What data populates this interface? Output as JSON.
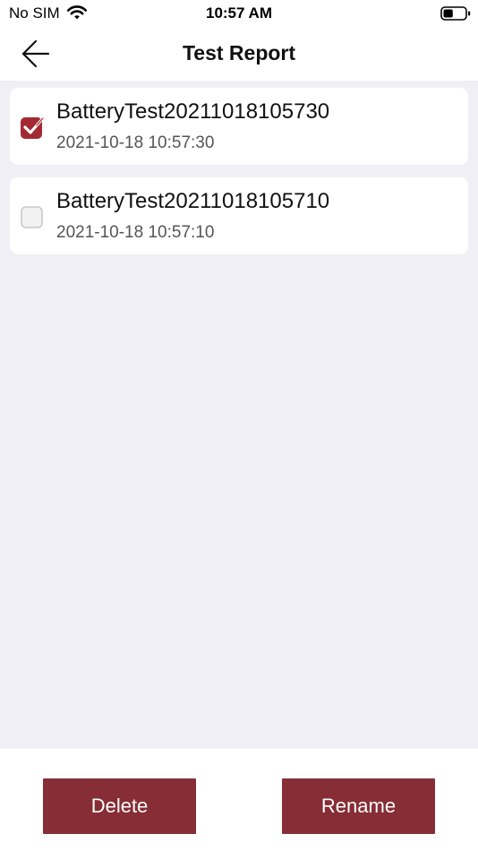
{
  "status_bar": {
    "carrier": "No SIM",
    "time": "10:57 AM",
    "wifi_icon": "wifi-icon",
    "battery_icon": "battery-icon",
    "battery_level": 0.45
  },
  "header": {
    "title": "Test Report",
    "back_icon": "arrow-left-icon"
  },
  "reports": [
    {
      "name": "BatteryTest20211018105730",
      "date": "2021-10-18 10:57:30",
      "checked": true
    },
    {
      "name": "BatteryTest20211018105710",
      "date": "2021-10-18 10:57:10",
      "checked": false
    }
  ],
  "actions": {
    "delete_label": "Delete",
    "rename_label": "Rename"
  },
  "colors": {
    "accent": "#862d35",
    "checkbox_checked": "#a32a33",
    "background": "#f0eff5"
  }
}
